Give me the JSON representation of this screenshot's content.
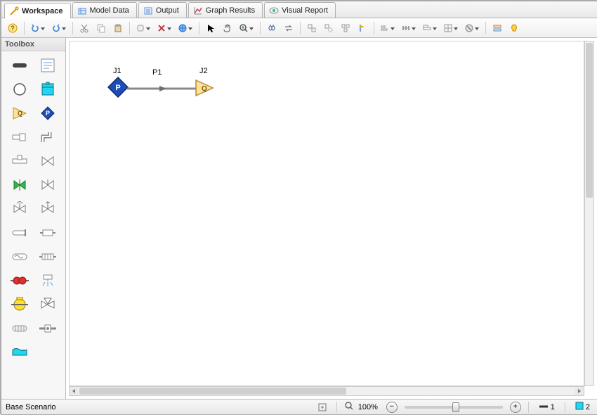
{
  "tabs": [
    {
      "label": "Workspace",
      "active": true
    },
    {
      "label": "Model Data",
      "active": false
    },
    {
      "label": "Output",
      "active": false
    },
    {
      "label": "Graph Results",
      "active": false
    },
    {
      "label": "Visual Report",
      "active": false
    }
  ],
  "toolbox": {
    "title": "Toolbox"
  },
  "diagram": {
    "j1": {
      "label": "J1",
      "letter": "P"
    },
    "p1": {
      "label": "P1"
    },
    "j2": {
      "label": "J2",
      "letter": "Q"
    }
  },
  "status": {
    "scenario": "Base Scenario",
    "zoom_pct": "100%",
    "pipe_count": "1",
    "jct_count": "2"
  }
}
